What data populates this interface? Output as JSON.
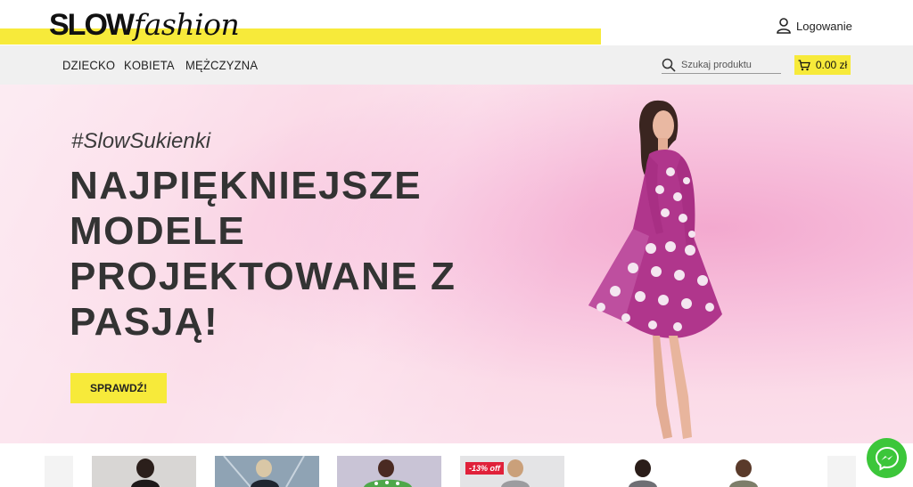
{
  "brand": {
    "part1": "SLOW",
    "part2": "fashion"
  },
  "header": {
    "login_label": "Logowanie",
    "login_icon": "user-icon"
  },
  "nav": {
    "items": [
      {
        "label": "DZIECKO"
      },
      {
        "label": "KOBIETA"
      },
      {
        "label": "MĘŻCZYZNA"
      }
    ]
  },
  "search": {
    "placeholder": "Szukaj produktu",
    "icon": "search-icon"
  },
  "cart": {
    "total": "0.00 zł",
    "icon": "cart-icon"
  },
  "hero": {
    "hashtag": "#SlowSukienki",
    "headline": "NAJPIĘKNIEJSZE MODELE PROJEKTOWANE Z PASJĄ!",
    "cta_label": "SPRAWDŹ!"
  },
  "products": {
    "badge": "-13% off"
  },
  "colors": {
    "accent": "#f7ea3a",
    "hero_bg": "#f8c4de",
    "badge": "#e0213a",
    "messenger": "#3cc63a"
  }
}
